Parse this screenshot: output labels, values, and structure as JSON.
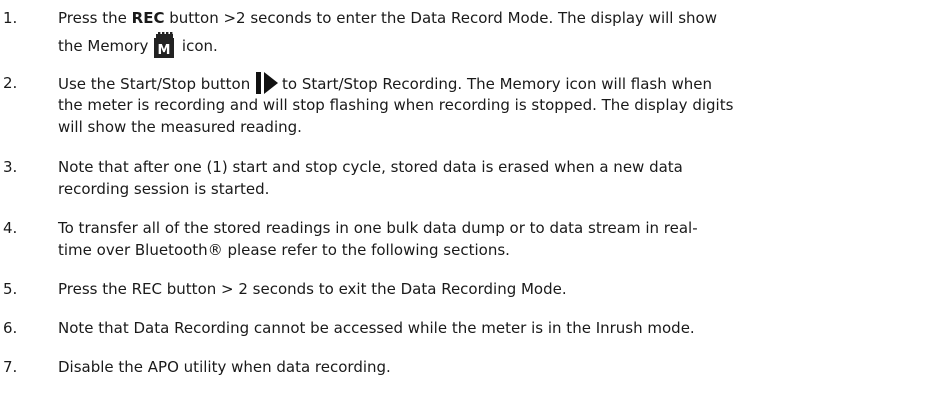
{
  "items": [
    {
      "number": "1.",
      "line1_pre": "Press the ",
      "line1_bold": "REC",
      "line1_post": " button >2 seconds to enter the Data Record Mode. The display will show",
      "line2_pre": "the Memory ",
      "icon_letter": "M",
      "line2_post": " icon."
    },
    {
      "number": "2.",
      "line1_pre": "Use the Start/Stop button ",
      "line1_post": "to Start/Stop Recording. The Memory icon will flash when",
      "line2": "the meter is recording and will stop flashing when recording is stopped. The display digits",
      "line3": "will show the measured reading."
    },
    {
      "number": "3.",
      "line1": "Note that after one (1) start and stop cycle, stored data is erased when a new data",
      "line2": "recording session is started."
    },
    {
      "number": "4.",
      "line1": "To transfer all of the stored readings in one bulk data dump or to data stream in real-",
      "line2": "time over Bluetooth® please refer to the following sections."
    },
    {
      "number": "5.",
      "line1": "Press the REC button > 2 seconds to exit the Data Recording Mode."
    },
    {
      "number": "6.",
      "line1": "Note that Data Recording cannot be accessed while the meter is in the Inrush mode."
    },
    {
      "number": "7.",
      "line1": "Disable the APO utility when data recording."
    }
  ],
  "icons": {
    "memory": "memory-card-icon",
    "start_stop": "play-pause-icon"
  }
}
